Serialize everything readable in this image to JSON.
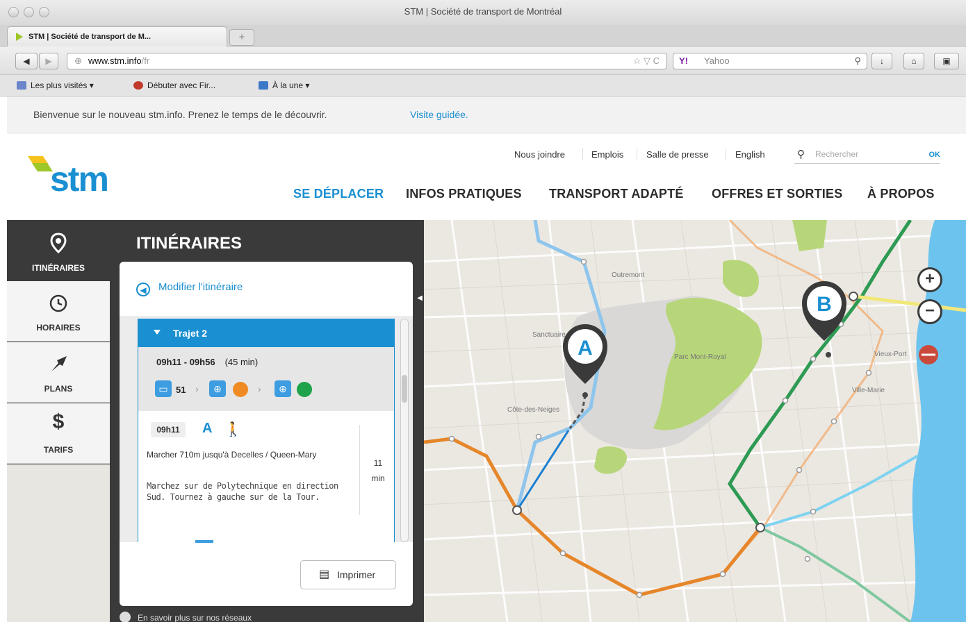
{
  "window": {
    "title": "STM | Société de transport de Montréal",
    "tab_title": "STM | Société de transport de M...",
    "new_tab": "+"
  },
  "toolbar": {
    "back": "◀",
    "forward": "▶",
    "url_domain": "www.stm.info",
    "url_path": "/fr",
    "url_icons": "☆ ▽ C",
    "search_engine": "Y!",
    "search_placeholder": "Yahoo",
    "search_icon": "🔍",
    "download_icon": "↓",
    "home_icon": "⌂",
    "menu_icon": "▣"
  },
  "bookmarks": [
    {
      "label": "Les plus visités ▾",
      "icon": "folder-icon",
      "color": "#6a85c9"
    },
    {
      "label": "Débuter avec Fir...",
      "icon": "firefox-icon",
      "color": "#c0392b"
    },
    {
      "label": "À la une ▾",
      "icon": "rss-icon",
      "color": "#3c78c8"
    }
  ],
  "welcome": {
    "text": "Bienvenue sur le nouveau stm.info. Prenez le temps de le découvrir.",
    "link": "Visite guidée."
  },
  "header": {
    "logo_text": "stm",
    "utility_links": [
      "Nous joindre",
      "Emplois",
      "Salle de presse",
      "English"
    ],
    "search_placeholder": "Rechercher",
    "search_ok": "OK",
    "main_nav": [
      "SE DÉPLACER",
      "INFOS PRATIQUES",
      "TRANSPORT ADAPTÉ",
      "OFFRES ET SORTIES",
      "À PROPOS"
    ],
    "active_nav_color": "#1a8fd1"
  },
  "sidebar": {
    "items": [
      {
        "label": "ITINÉRAIRES",
        "icon": "map-pin-icon",
        "active": true
      },
      {
        "label": "HORAIRES",
        "icon": "clock-icon",
        "active": false
      },
      {
        "label": "PLANS",
        "icon": "map-icon",
        "active": false
      },
      {
        "label": "TARIFS",
        "icon": "dollar-icon",
        "active": false
      }
    ]
  },
  "panel": {
    "title": "ITINÉRAIRES",
    "modify_label": "Modifier l'itinéraire",
    "trajet": {
      "title": "Trajet 2",
      "time_range": "09h11 - 09h56",
      "duration": "(45 min)",
      "bus_number": "51",
      "metro_orange": "#f08a24",
      "metro_green": "#1fa34a",
      "step": {
        "time": "09h11",
        "point": "A",
        "walk_icon": "🚶",
        "instruction": "Marcher 710m jusqu'à Decelles / Queen-Mary",
        "detail": "Marchez sur de Polytechnique en direction Sud. Tournez à gauche sur de la Tour.",
        "minutes": "11",
        "min_unit": "min"
      }
    },
    "print_label": "Imprimer",
    "footnote": "En savoir plus sur nos réseaux"
  },
  "map": {
    "pin_a": "A",
    "pin_b": "B",
    "zoom_in": "+",
    "zoom_out": "−",
    "labels": [
      "Sanctuaire",
      "Côte-des-Neiges",
      "Parc Mont-Royal",
      "Outremont",
      "Ville-Marie",
      "Vieux-Port"
    ]
  }
}
